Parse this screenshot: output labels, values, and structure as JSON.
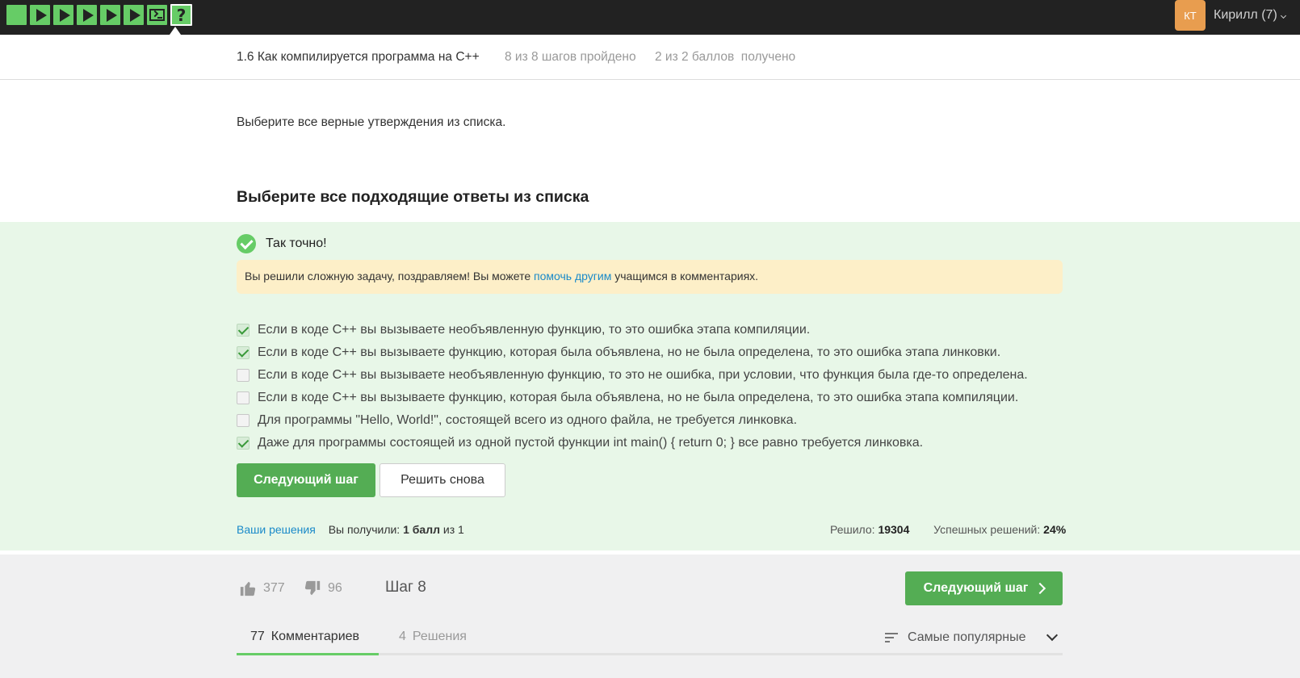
{
  "topbar": {
    "steps": [
      "text-step",
      "code-step",
      "code-step",
      "code-step",
      "code-step",
      "code-step",
      "terminal-step",
      "quiz-step"
    ],
    "avatar_initials": "КТ",
    "username": "Кирилл (7)"
  },
  "lesson": {
    "title": "1.6 Как компилируется программа на C++",
    "progress": "8 из 8 шагов пройдено",
    "score": "2 из 2 баллов  получено"
  },
  "question": "Выберите все верные утверждения из списка.",
  "quiz": {
    "title": "Выберите все подходящие ответы из списка",
    "result_text": "Так точно!",
    "congrats_before": "Вы решили сложную задачу, поздравляем! Вы можете ",
    "congrats_link": "помочь другим",
    "congrats_after": " учащимся в комментариях.",
    "options": [
      {
        "text": "Если в коде C++ вы вызываете необъявленную функцию, то это ошибка этапа компиляции.",
        "checked": true
      },
      {
        "text": "Если в коде C++ вы вызываете функцию, которая была объявлена, но не была определена, то это ошибка этапа линковки.",
        "checked": true
      },
      {
        "text": "Если в коде C++ вы вызываете необъявленную функцию, то это не ошибка, при условии, что функция была где-то определена.",
        "checked": false
      },
      {
        "text": "Если в коде C++ вы вызываете функцию, которая была объявлена, но не была определена, то это ошибка этапа компиляции.",
        "checked": false
      },
      {
        "text": "Для программы \"Hello, World!\", состоящей всего из одного файла, не требуется линковка.",
        "checked": false
      },
      {
        "text": "Даже для программы состоящей из одной пустой функции int main() { return 0; } все равно требуется линковка.",
        "checked": true
      }
    ],
    "next_button": "Следующий шаг",
    "retry_button": "Решить снова",
    "your_solutions": "Ваши решения",
    "received_label": "Вы получили:",
    "received_value": "1 балл",
    "received_of": "из 1",
    "solved_label": "Решило:",
    "solved_value": "19304",
    "success_label": "Успешных решений:",
    "success_value": "24%"
  },
  "footer": {
    "likes": "377",
    "dislikes": "96",
    "step_label": "Шаг 8",
    "next_button": "Следующий шаг",
    "tabs": [
      {
        "count": "77",
        "label": "Комментариев"
      },
      {
        "count": "4",
        "label": "Решения"
      }
    ],
    "sort_label": "Самые популярные"
  },
  "colors": {
    "topbar": "#222222",
    "accent_green": "#54ad54",
    "result_bg": "#e8f7e8",
    "congrats_bg": "#fdefc8",
    "link": "#1a8ac9"
  }
}
